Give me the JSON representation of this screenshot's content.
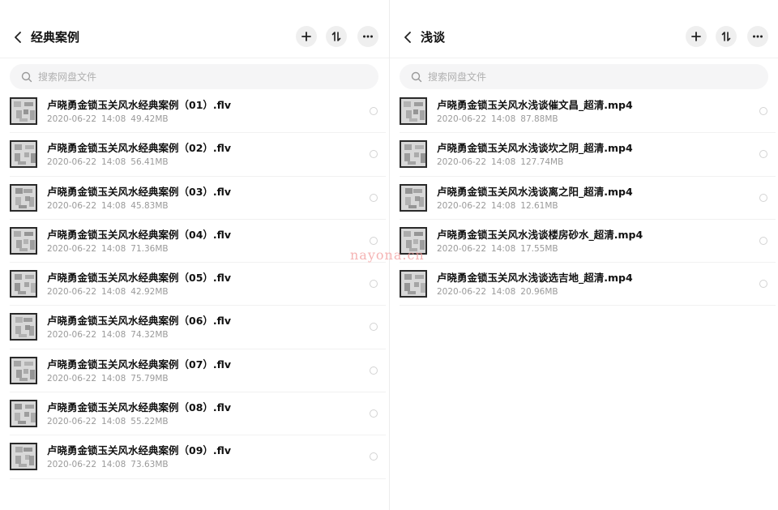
{
  "left_panel": {
    "title": "经典案例",
    "search_placeholder": "搜索网盘文件",
    "header_icons": [
      "back-icon",
      "plus-icon",
      "sort-icon",
      "more-icon"
    ],
    "files": [
      {
        "name": "卢晓勇金锁玉关风水经典案例（01）.flv",
        "date": "2020-06-22",
        "time": "14:08",
        "size": "49.42MB"
      },
      {
        "name": "卢晓勇金锁玉关风水经典案例（02）.flv",
        "date": "2020-06-22",
        "time": "14:08",
        "size": "56.41MB"
      },
      {
        "name": "卢晓勇金锁玉关风水经典案例（03）.flv",
        "date": "2020-06-22",
        "time": "14:08",
        "size": "45.83MB"
      },
      {
        "name": "卢晓勇金锁玉关风水经典案例（04）.flv",
        "date": "2020-06-22",
        "time": "14:08",
        "size": "71.36MB"
      },
      {
        "name": "卢晓勇金锁玉关风水经典案例（05）.flv",
        "date": "2020-06-22",
        "time": "14:08",
        "size": "42.92MB"
      },
      {
        "name": "卢晓勇金锁玉关风水经典案例（06）.flv",
        "date": "2020-06-22",
        "time": "14:08",
        "size": "74.32MB"
      },
      {
        "name": "卢晓勇金锁玉关风水经典案例（07）.flv",
        "date": "2020-06-22",
        "time": "14:08",
        "size": "75.79MB"
      },
      {
        "name": "卢晓勇金锁玉关风水经典案例（08）.flv",
        "date": "2020-06-22",
        "time": "14:08",
        "size": "55.22MB"
      },
      {
        "name": "卢晓勇金锁玉关风水经典案例（09）.flv",
        "date": "2020-06-22",
        "time": "14:08",
        "size": "73.63MB"
      }
    ]
  },
  "right_panel": {
    "title": "浅谈",
    "search_placeholder": "搜索网盘文件",
    "header_icons": [
      "back-icon",
      "plus-icon",
      "sort-icon",
      "more-icon"
    ],
    "files": [
      {
        "name": "卢晓勇金锁玉关风水浅谈催文昌_超清.mp4",
        "date": "2020-06-22",
        "time": "14:08",
        "size": "87.88MB"
      },
      {
        "name": "卢晓勇金锁玉关风水浅谈坎之阴_超清.mp4",
        "date": "2020-06-22",
        "time": "14:08",
        "size": "127.74MB"
      },
      {
        "name": "卢晓勇金锁玉关风水浅谈离之阳_超清.mp4",
        "date": "2020-06-22",
        "time": "14:08",
        "size": "12.61MB"
      },
      {
        "name": "卢晓勇金锁玉关风水浅谈楼房砂水_超清.mp4",
        "date": "2020-06-22",
        "time": "14:08",
        "size": "17.55MB"
      },
      {
        "name": "卢晓勇金锁玉关风水浅谈选吉地_超清.mp4",
        "date": "2020-06-22",
        "time": "14:08",
        "size": "20.96MB"
      }
    ]
  },
  "watermark": "nayona.cn"
}
